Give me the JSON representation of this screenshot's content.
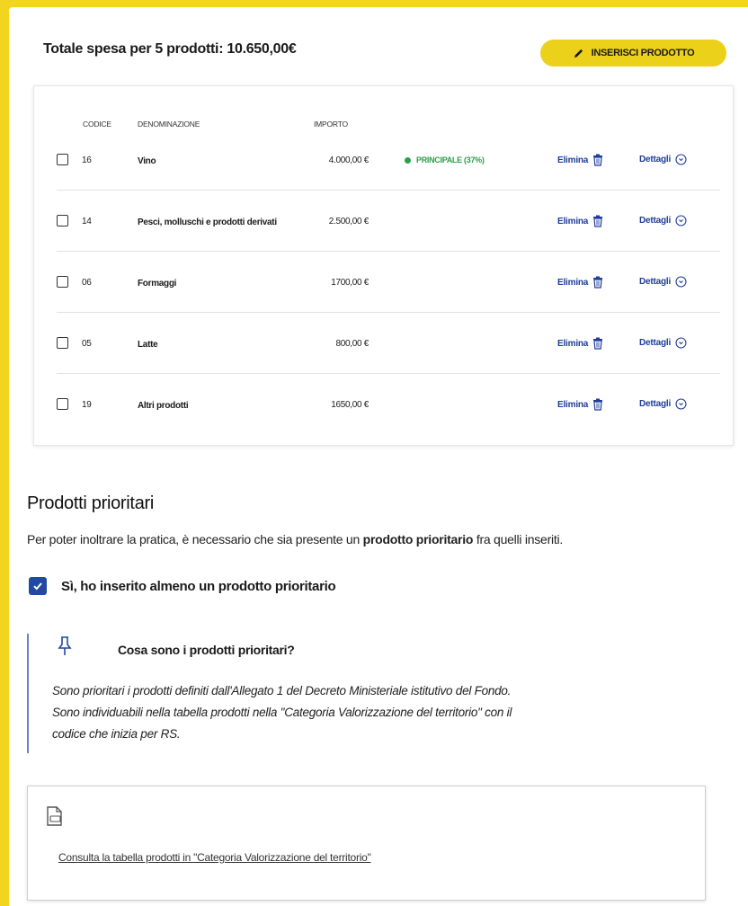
{
  "header": {
    "total_label": "Totale spesa per 5 prodotti: 10.650,00€",
    "add_button": "INSERISCI PRODOTTO"
  },
  "table": {
    "columns": {
      "code": "CODICE",
      "name": "DENOMINAZIONE",
      "amount": "IMPORTO"
    },
    "rows": [
      {
        "code": "16",
        "name": "Vino",
        "amount": "4.000,00 €",
        "badge": "PRINCIPALE (37%)",
        "delete": "Elimina",
        "details": "Dettagli"
      },
      {
        "code": "14",
        "name": "Pesci, molluschi e prodotti derivati",
        "amount": "2.500,00 €",
        "badge": "",
        "delete": "Elimina",
        "details": "Dettagli"
      },
      {
        "code": "06",
        "name": "Formaggi",
        "amount": "1700,00 €",
        "badge": "",
        "delete": "Elimina",
        "details": "Dettagli"
      },
      {
        "code": "05",
        "name": "Latte",
        "amount": "800,00 €",
        "badge": "",
        "delete": "Elimina",
        "details": "Dettagli"
      },
      {
        "code": "19",
        "name": "Altri prodotti",
        "amount": "1650,00 €",
        "badge": "",
        "delete": "Elimina",
        "details": "Dettagli"
      }
    ]
  },
  "priority": {
    "title": "Prodotti prioritari",
    "desc_pre": "Per poter inoltrare la pratica, è necessario che sia presente un ",
    "desc_bold": "prodotto prioritario",
    "desc_post": " fra quelli inseriti.",
    "confirm_label": "Sì, ho inserito almeno un prodotto prioritario",
    "confirm_checked": true
  },
  "info": {
    "title": "Cosa sono i prodotti prioritari?",
    "line1": "Sono prioritari i prodotti definiti dall'Allegato 1 del Decreto Ministeriale istitutivo del Fondo.",
    "line2": "Sono individuabili nella tabella prodotti nella \"Categoria Valorizzazione del territorio\" con il",
    "line3": "codice che inizia per RS."
  },
  "pdf": {
    "link_text": "Consulta la tabella prodotti in \"Categoria Valorizzazione del territorio\""
  },
  "colors": {
    "background": "#f2d51e",
    "accent_yellow": "#ecd11b",
    "link_blue": "#1f3d99",
    "badge_green": "#2aa04a",
    "checkbox_blue": "#1f4aa0"
  }
}
